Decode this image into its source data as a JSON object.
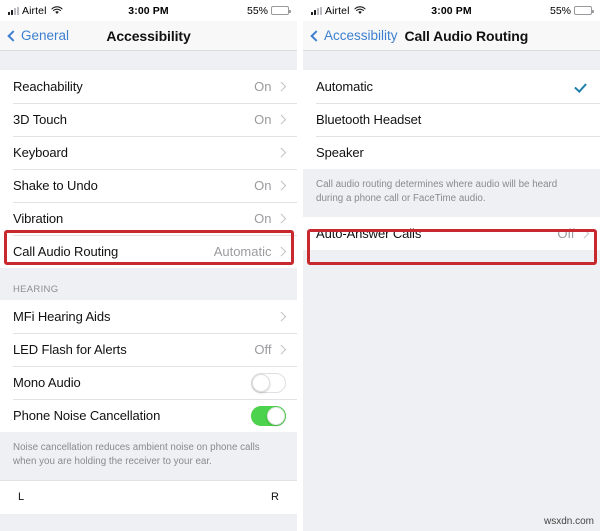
{
  "status_bar": {
    "carrier": "Airtel",
    "time": "3:00 PM",
    "battery_percent": "55%",
    "battery_level": 55,
    "signal_icon": "cellular-signal-icon",
    "wifi_icon": "wifi-icon",
    "battery_icon": "battery-icon"
  },
  "colors": {
    "accent_blue": "#3c7fd0",
    "check_blue": "#1f7fa8",
    "toggle_green": "#4cd24c",
    "highlight_red": "#c8292e",
    "group_background": "#eff0f3"
  },
  "left_panel": {
    "nav": {
      "back_label": "General",
      "title": "Accessibility"
    },
    "group_interaction": [
      {
        "label": "Reachability",
        "value": "On",
        "accessory": "chevron"
      },
      {
        "label": "3D Touch",
        "value": "On",
        "accessory": "chevron"
      },
      {
        "label": "Keyboard",
        "value": "",
        "accessory": "chevron"
      },
      {
        "label": "Shake to Undo",
        "value": "On",
        "accessory": "chevron"
      },
      {
        "label": "Vibration",
        "value": "On",
        "accessory": "chevron"
      },
      {
        "label": "Call Audio Routing",
        "value": "Automatic",
        "accessory": "chevron",
        "highlighted": true
      }
    ],
    "hearing_header": "HEARING",
    "group_hearing": [
      {
        "label": "MFi Hearing Aids",
        "value": "",
        "accessory": "chevron"
      },
      {
        "label": "LED Flash for Alerts",
        "value": "Off",
        "accessory": "chevron"
      },
      {
        "label": "Mono Audio",
        "value": "",
        "accessory": "switch",
        "switch_on": false
      },
      {
        "label": "Phone Noise Cancellation",
        "value": "",
        "accessory": "switch",
        "switch_on": true
      }
    ],
    "footnote": "Noise cancellation reduces ambient noise on phone calls when you are holding the receiver to your ear.",
    "balance": {
      "left_label": "L",
      "right_label": "R"
    }
  },
  "right_panel": {
    "nav": {
      "back_label": "Accessibility",
      "title": "Call Audio Routing"
    },
    "options": [
      {
        "label": "Automatic",
        "accessory": "check",
        "selected": true
      },
      {
        "label": "Bluetooth Headset",
        "accessory": "none",
        "selected": false
      },
      {
        "label": "Speaker",
        "accessory": "none",
        "selected": false
      }
    ],
    "footnote": "Call audio routing determines where audio will be heard during a phone call or FaceTime audio.",
    "group_auto_answer": [
      {
        "label": "Auto-Answer Calls",
        "value": "Off",
        "accessory": "chevron",
        "highlighted": true
      }
    ]
  },
  "watermark": "wsxdn.com"
}
